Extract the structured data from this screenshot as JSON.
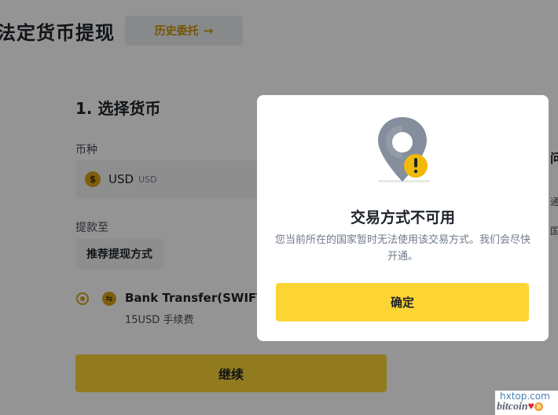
{
  "page": {
    "title": "法定货币提现",
    "history_button": "历史委托",
    "step_title": "1. 选择货币",
    "currency_label": "币种",
    "currency_icon": "dollar-coin-icon",
    "currency_name": "USD",
    "currency_code": "USD",
    "withdraw_to_label": "提款至",
    "recommend_button": "推荐提现方式",
    "method_name": "Bank Transfer(SWIFT)",
    "method_fee": "15USD 手续费",
    "continue_button": "继续",
    "side_heading_fragment": "问",
    "side_text_1_fragment": "通",
    "side_text_2_fragment": "国"
  },
  "modal": {
    "title": "交易方式不可用",
    "description": "您当前所在的国家暂时无法使用该交易方式。我们会尽快开通。",
    "confirm_button": "确定",
    "illustration": "location-pin-warning-icon"
  },
  "watermark": {
    "line1": "hxtop.com",
    "line2": "bitcoin"
  },
  "colors": {
    "accent": "#fcd535",
    "accent_text": "#c99400",
    "overlay": "rgba(0,0,0,0.42)"
  }
}
